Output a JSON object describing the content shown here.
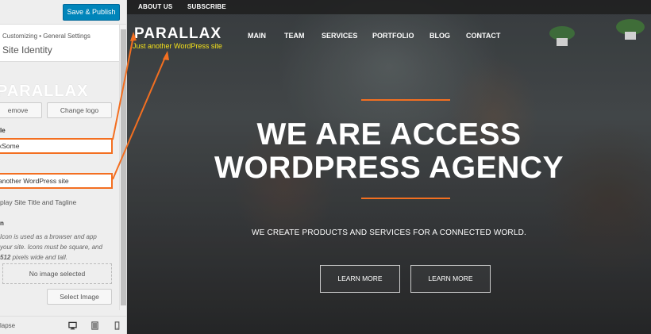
{
  "customizer": {
    "publish_label": "Save & Publish",
    "breadcrumb": "Customizing • General Settings",
    "section_title": "Site Identity",
    "logo_preview": "PARALLAX",
    "remove_label": "emove",
    "change_logo_label": "Change logo",
    "site_title_label": "le",
    "site_title_value": "xSome",
    "tagline_value": "another WordPress site",
    "display_title_label": "play Site Title and Tagline",
    "site_icon_label": "n",
    "site_icon_desc_1": "Icon is used as a browser and app",
    "site_icon_desc_2": "your site. Icons must be square, and",
    "site_icon_desc_3_bold": "512",
    "site_icon_desc_3_rest": " pixels wide and tall.",
    "no_image_label": "No image selected",
    "select_image_label": "Select Image",
    "collapse_label": "lapse"
  },
  "site": {
    "topbar": [
      "ABOUT US",
      "SUBSCRIBE"
    ],
    "title": "PARALLAX",
    "tagline": "Just another WordPress site",
    "nav": [
      "MAIN",
      "TEAM",
      "SERVICES",
      "PORTFOLIO",
      "BLOG",
      "CONTACT"
    ],
    "hero_line1": "WE ARE ACCESS",
    "hero_line2": "WORDPRESS AGENCY",
    "hero_sub": "WE CREATE PRODUCTS AND SERVICES FOR A CONNECTED WORLD.",
    "button_1": "LEARN MORE",
    "button_2": "LEARN MORE"
  },
  "colors": {
    "accent_orange": "#f36f21",
    "publish_blue": "#0085ba",
    "tagline_yellow": "#f5e21b"
  },
  "icons": [
    "desktop-icon",
    "tablet-icon",
    "mobile-icon"
  ]
}
